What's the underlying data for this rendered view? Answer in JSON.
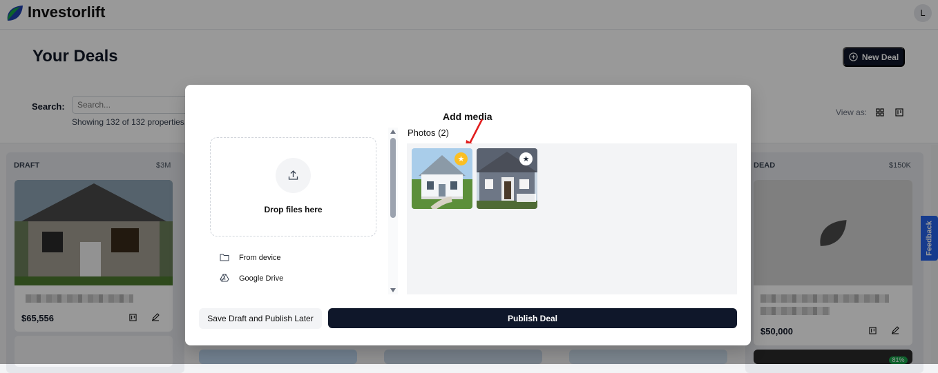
{
  "app": {
    "brand": "Investorlift",
    "avatar_initial": "L"
  },
  "page": {
    "title": "Your Deals",
    "new_deal_label": "New Deal",
    "search_label": "Search:",
    "search_placeholder": "Search...",
    "showing": "Showing 132 of 132 properties.",
    "view_as": "View as:"
  },
  "columns": [
    {
      "title": "DRAFT",
      "total": "$3M",
      "card_price": "$65,556"
    },
    {
      "title": "DEAD",
      "total": "$150K",
      "card_price": "$50,000"
    }
  ],
  "bottom_badge": "81%",
  "feedback_label": "Feedback",
  "modal": {
    "title": "Add media",
    "drop_text": "Drop files here",
    "sources": [
      "From device",
      "Google Drive"
    ],
    "photos_label": "Photos (2)",
    "save_draft_label": "Save Draft and Publish Later",
    "publish_label": "Publish Deal"
  },
  "colors": {
    "primary": "#0f172a",
    "cover_star": "#fbbf24",
    "feedback": "#2563eb",
    "annotation_arrow": "#e11d1d"
  },
  "icons": [
    "leaf-logo-icon",
    "plus-circle-icon",
    "grid-view-icon",
    "board-view-icon",
    "upload-icon",
    "folder-icon",
    "google-drive-icon",
    "star-icon",
    "edit-icon",
    "map-icon"
  ]
}
